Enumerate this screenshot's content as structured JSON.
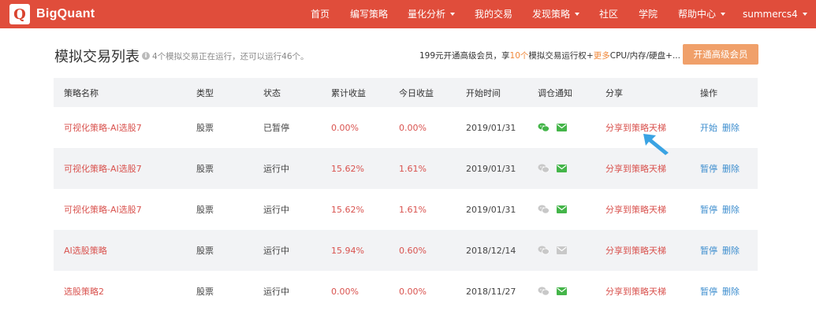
{
  "brand": {
    "logo_letter": "Q",
    "name": "BigQuant"
  },
  "nav": {
    "items": [
      {
        "label": "首页",
        "dropdown": false
      },
      {
        "label": "编写策略",
        "dropdown": false
      },
      {
        "label": "量化分析",
        "dropdown": true
      },
      {
        "label": "我的交易",
        "dropdown": false
      },
      {
        "label": "发现策略",
        "dropdown": true
      },
      {
        "label": "社区",
        "dropdown": false
      },
      {
        "label": "学院",
        "dropdown": false
      },
      {
        "label": "帮助中心",
        "dropdown": true
      }
    ],
    "user": "summercs4"
  },
  "header": {
    "title": "模拟交易列表",
    "info_icon": "info-circle-icon",
    "subtitle": "4个模拟交易正在运行，还可以运行46个。",
    "promo": {
      "part1": "199元开通高级会员，享",
      "highlight1": "10个",
      "part2": "模拟交易运行权+",
      "highlight2": "更多",
      "part3": "CPU/内存/硬盘+..."
    },
    "vip_button": "开通高级会员"
  },
  "table": {
    "columns": [
      "策略名称",
      "类型",
      "状态",
      "累计收益",
      "今日收益",
      "开始时间",
      "调仓通知",
      "分享",
      "操作"
    ],
    "rows": [
      {
        "name": "可视化策略-AI选股7",
        "type": "股票",
        "status": "已暂停",
        "total": "0.00%",
        "today": "0.00%",
        "start": "2019/01/31",
        "wechat_on": true,
        "mail_on": true,
        "share": "分享到策略天梯",
        "op1": "开始",
        "op2": "删除"
      },
      {
        "name": "可视化策略-AI选股7",
        "type": "股票",
        "status": "运行中",
        "total": "15.62%",
        "today": "1.61%",
        "start": "2019/01/31",
        "wechat_on": false,
        "mail_on": true,
        "share": "分享到策略天梯",
        "op1": "暂停",
        "op2": "删除"
      },
      {
        "name": "可视化策略-AI选股7",
        "type": "股票",
        "status": "运行中",
        "total": "15.62%",
        "today": "1.61%",
        "start": "2019/01/31",
        "wechat_on": false,
        "mail_on": true,
        "share": "分享到策略天梯",
        "op1": "暂停",
        "op2": "删除"
      },
      {
        "name": "AI选股策略",
        "type": "股票",
        "status": "运行中",
        "total": "15.94%",
        "today": "0.60%",
        "start": "2018/12/14",
        "wechat_on": false,
        "mail_on": false,
        "share": "分享到策略天梯",
        "op1": "暂停",
        "op2": "删除"
      },
      {
        "name": "选股策略2",
        "type": "股票",
        "status": "运行中",
        "total": "0.00%",
        "today": "0.00%",
        "start": "2018/11/27",
        "wechat_on": false,
        "mail_on": true,
        "share": "分享到策略天梯",
        "op1": "暂停",
        "op2": "删除"
      }
    ]
  },
  "colors": {
    "brand": "#e04d3b",
    "wechat_on": "#44b549",
    "mail_on": "#44b549",
    "icon_off": "#c8c8c8",
    "link": "#3c8dce",
    "pointer": "#3aa3e3"
  }
}
